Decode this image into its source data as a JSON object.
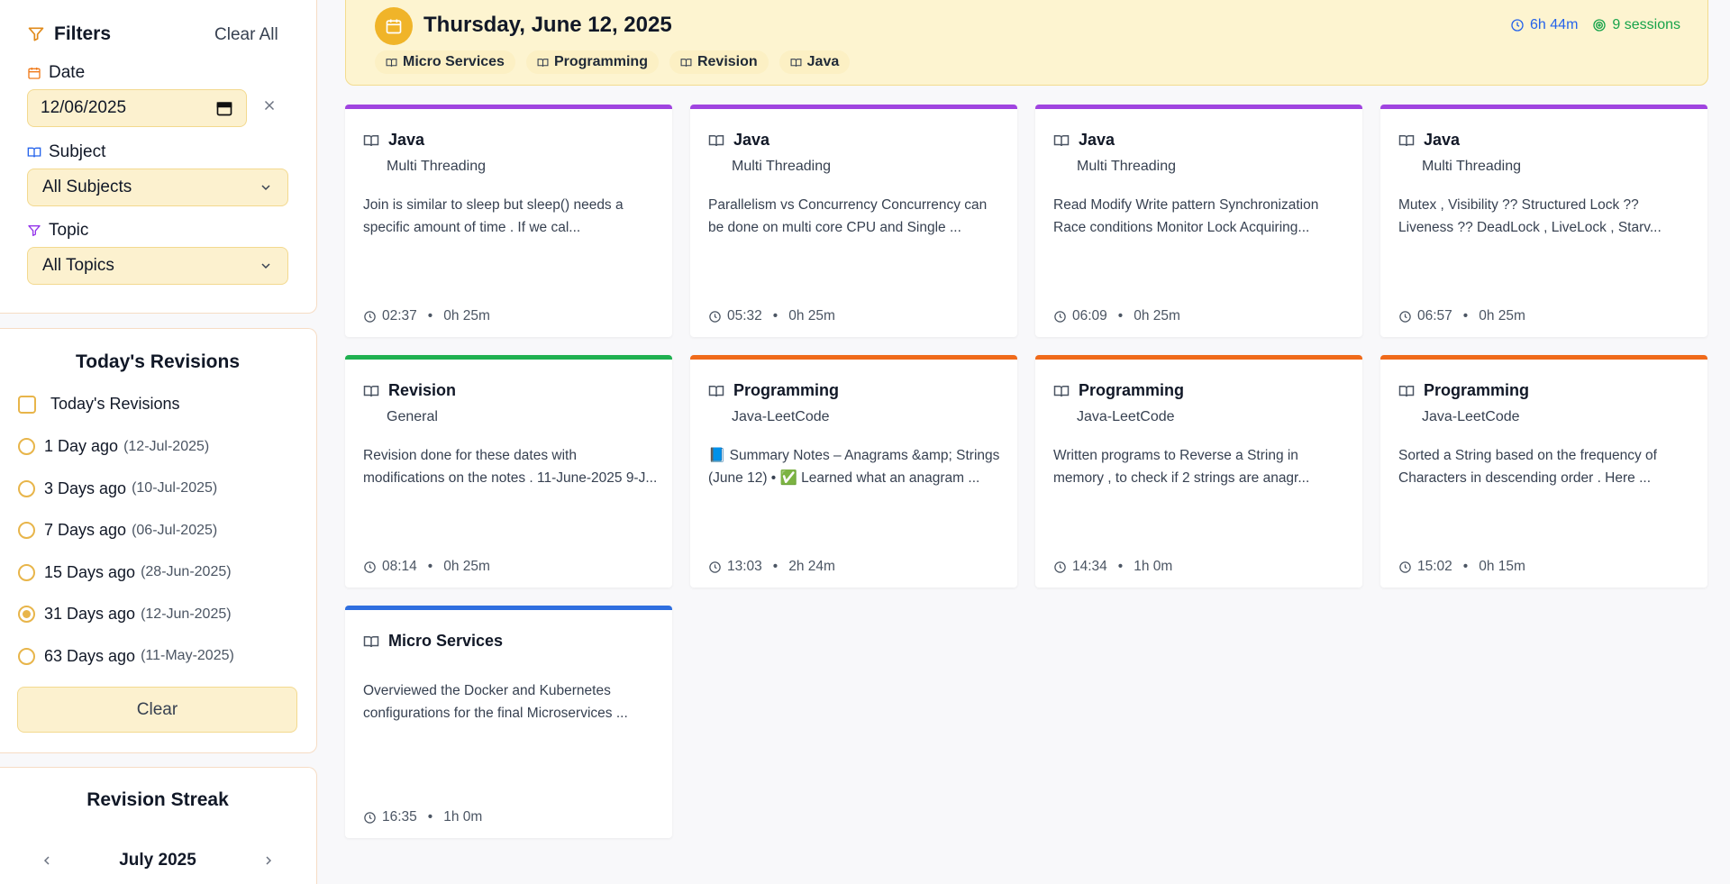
{
  "filters": {
    "title": "Filters",
    "clear_all": "Clear All",
    "date_label": "Date",
    "date_value": "12/06/2025",
    "subject_label": "Subject",
    "subject_value": "All Subjects",
    "topic_label": "Topic",
    "topic_value": "All Topics"
  },
  "revisions": {
    "title": "Today's Revisions",
    "checkbox_label": "Today's Revisions",
    "options": [
      {
        "label": "1 Day ago",
        "date": "(12-Jul-2025)",
        "selected": false
      },
      {
        "label": "3 Days ago",
        "date": "(10-Jul-2025)",
        "selected": false
      },
      {
        "label": "7 Days ago",
        "date": "(06-Jul-2025)",
        "selected": false
      },
      {
        "label": "15 Days ago",
        "date": "(28-Jun-2025)",
        "selected": false
      },
      {
        "label": "31 Days ago",
        "date": "(12-Jun-2025)",
        "selected": true
      },
      {
        "label": "63 Days ago",
        "date": "(11-May-2025)",
        "selected": false
      }
    ],
    "clear_label": "Clear"
  },
  "streak": {
    "title": "Revision Streak",
    "month": "July 2025",
    "prev": "‹",
    "next": "›"
  },
  "day": {
    "title": "Thursday, June 12, 2025",
    "total_time": "6h 44m",
    "sessions": "9 sessions",
    "tags": [
      "Micro Services",
      "Programming",
      "Revision",
      "Java"
    ]
  },
  "colors": {
    "java": "#a044e0",
    "revision": "#1fb050",
    "programming": "#f06a1a",
    "micro_services": "#2f6fe0",
    "accent": "#f0b429"
  },
  "cards": [
    {
      "subject": "Java",
      "topic": "Multi Threading",
      "desc": "Join is similar to sleep but sleep() needs a specific amount of time . If we cal...",
      "time": "02:37",
      "duration": "0h 25m",
      "color": "#a044e0"
    },
    {
      "subject": "Java",
      "topic": "Multi Threading",
      "desc": "Parallelism vs Concurrency Concurrency can be done on multi core CPU and Single ...",
      "time": "05:32",
      "duration": "0h 25m",
      "color": "#a044e0"
    },
    {
      "subject": "Java",
      "topic": "Multi Threading",
      "desc": "Read Modify Write pattern Synchronization Race conditions Monitor Lock Acquiring...",
      "time": "06:09",
      "duration": "0h 25m",
      "color": "#a044e0"
    },
    {
      "subject": "Java",
      "topic": "Multi Threading",
      "desc": "Mutex , Visibility ?? Structured Lock ?? Liveness ?? DeadLock , LiveLock , Starv...",
      "time": "06:57",
      "duration": "0h 25m",
      "color": "#a044e0"
    },
    {
      "subject": "Revision",
      "topic": "General",
      "desc": "Revision done for these dates with modifications on the notes . 11-June-2025 9-J...",
      "time": "08:14",
      "duration": "0h 25m",
      "color": "#1fb050"
    },
    {
      "subject": "Programming",
      "topic": "Java-LeetCode",
      "desc": "📘 Summary Notes – Anagrams &amp; Strings (June 12) • ✅ Learned what an anagram ...",
      "time": "13:03",
      "duration": "2h 24m",
      "color": "#f06a1a"
    },
    {
      "subject": "Programming",
      "topic": "Java-LeetCode",
      "desc": "Written programs to Reverse a String in memory , to check if 2 strings are anagr...",
      "time": "14:34",
      "duration": "1h 0m",
      "color": "#f06a1a"
    },
    {
      "subject": "Programming",
      "topic": "Java-LeetCode",
      "desc": "Sorted a String based on the frequency of Characters in descending order . Here ...",
      "time": "15:02",
      "duration": "0h 15m",
      "color": "#f06a1a"
    },
    {
      "subject": "Micro Services",
      "topic": "",
      "desc": "Overviewed the Docker and Kubernetes configurations for the final Microservices ...",
      "time": "16:35",
      "duration": "1h 0m",
      "color": "#2f6fe0"
    }
  ]
}
